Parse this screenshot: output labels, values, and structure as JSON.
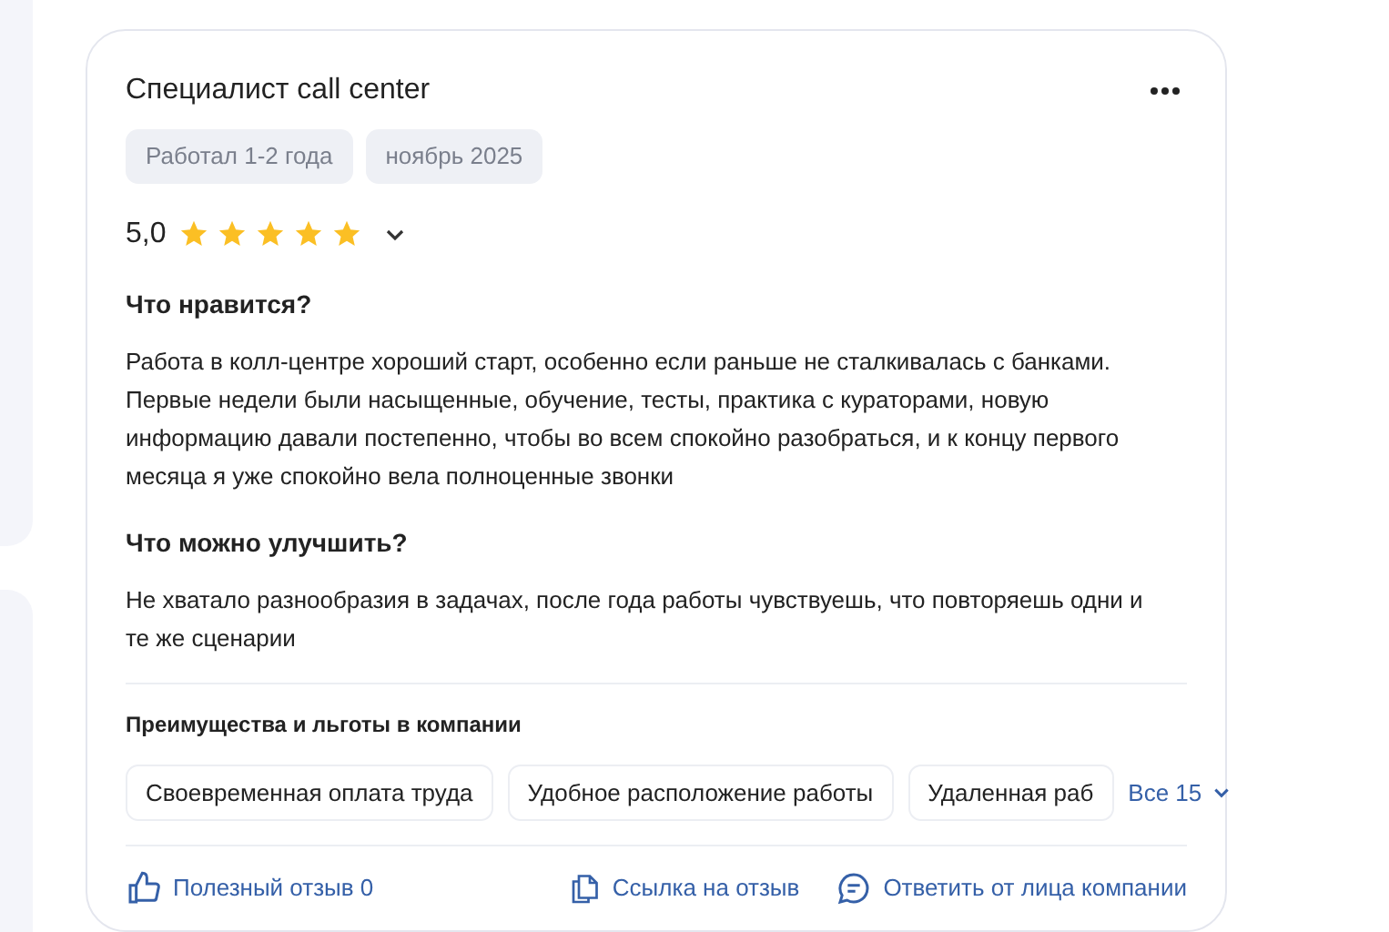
{
  "review": {
    "title": "Специалист call center",
    "tags": [
      "Работал 1-2 года",
      "ноябрь 2025"
    ],
    "rating": "5,0",
    "stars": 5,
    "sections": [
      {
        "heading": "Что нравится?",
        "text": "Работа в колл-центре хороший старт, особенно если раньше не сталкивалась с банками. Первые недели были насыщенные, обучение, тесты, практика с кураторами, новую информацию давали постепенно, чтобы во всем спокойно разобраться, и к концу первого месяца я уже спокойно вела полноценные звонки"
      },
      {
        "heading": "Что можно улучшить?",
        "text": "Не хватало разнообразия в задачах, после года работы чувствуешь, что повторяешь одни и те же сценарии"
      }
    ],
    "benefits": {
      "heading": "Преимущества и льготы в компании",
      "items": [
        "Своевременная оплата труда",
        "Удобное расположение работы",
        "Удаленная раб"
      ],
      "more": "Все 15"
    },
    "actions": [
      {
        "kind": "like",
        "label": "Полезный отзыв 0"
      },
      {
        "kind": "link",
        "label": "Ссылка на отзыв"
      },
      {
        "kind": "reply",
        "label": "Ответить от лица компании"
      }
    ]
  }
}
